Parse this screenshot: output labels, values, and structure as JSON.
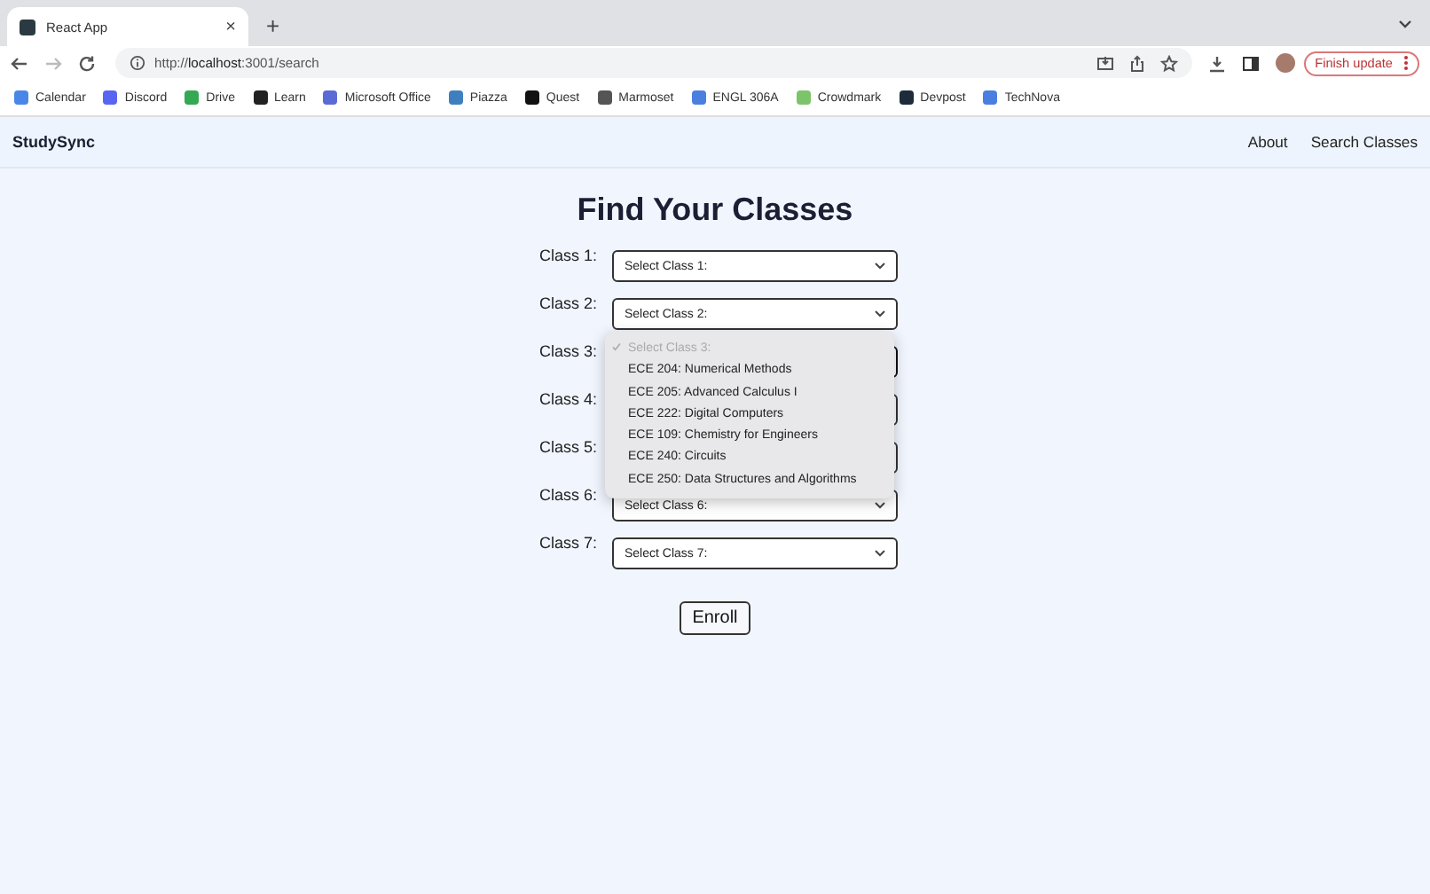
{
  "browser": {
    "tab": {
      "title": "React App",
      "close": "×"
    },
    "new_tab": "+",
    "url_prefix": "http://",
    "url_host": "localhost",
    "url_rest": ":3001/search",
    "update_button": "Finish update",
    "bookmarks": [
      {
        "label": "Calendar",
        "color": "#4a86e8"
      },
      {
        "label": "Discord",
        "color": "#5865f2"
      },
      {
        "label": "Drive",
        "color": "#34a853"
      },
      {
        "label": "Learn",
        "color": "#222222"
      },
      {
        "label": "Microsoft Office",
        "color": "#5b6bd5"
      },
      {
        "label": "Piazza",
        "color": "#3f7fbf"
      },
      {
        "label": "Quest",
        "color": "#111111"
      },
      {
        "label": "Marmoset",
        "color": "#555555"
      },
      {
        "label": "ENGL 306A",
        "color": "#4a7fe0"
      },
      {
        "label": "Crowdmark",
        "color": "#7cc46a"
      },
      {
        "label": "Devpost",
        "color": "#1d2b3a"
      },
      {
        "label": "TechNova",
        "color": "#4a7fe0"
      }
    ]
  },
  "navbar": {
    "brand": "StudySync",
    "links": [
      "About",
      "Search Classes"
    ]
  },
  "heading": "Find Your Classes",
  "classes": [
    {
      "label": "Class 1:",
      "value": "Select Class 1:",
      "open": false
    },
    {
      "label": "Class 2:",
      "value": "Select Class 2:",
      "open": false
    },
    {
      "label": "Class 3:",
      "open": true
    },
    {
      "label": "Class 4:",
      "open": false
    },
    {
      "label": "Class 5:",
      "open": false
    },
    {
      "label": "Class 6:",
      "value": "Select Class 6:",
      "open": false
    },
    {
      "label": "Class 7:",
      "value": "Select Class 7:",
      "open": false
    }
  ],
  "dropdown": {
    "options": [
      {
        "label": "Select Class 3:",
        "selected": true,
        "disabled": true
      },
      {
        "label": "ECE 204: Numerical Methods",
        "selected": false,
        "disabled": false
      },
      {
        "label": "ECE 205: Advanced Calculus I",
        "selected": false,
        "disabled": false
      },
      {
        "label": "ECE 222: Digital Computers",
        "selected": false,
        "disabled": false
      },
      {
        "label": "ECE 109: Chemistry for Engineers",
        "selected": false,
        "disabled": false
      },
      {
        "label": "ECE 240: Circuits",
        "selected": false,
        "disabled": false
      },
      {
        "label": "ECE 250: Data Structures and Algorithms",
        "selected": false,
        "disabled": false
      }
    ]
  },
  "enroll_button": "Enroll"
}
